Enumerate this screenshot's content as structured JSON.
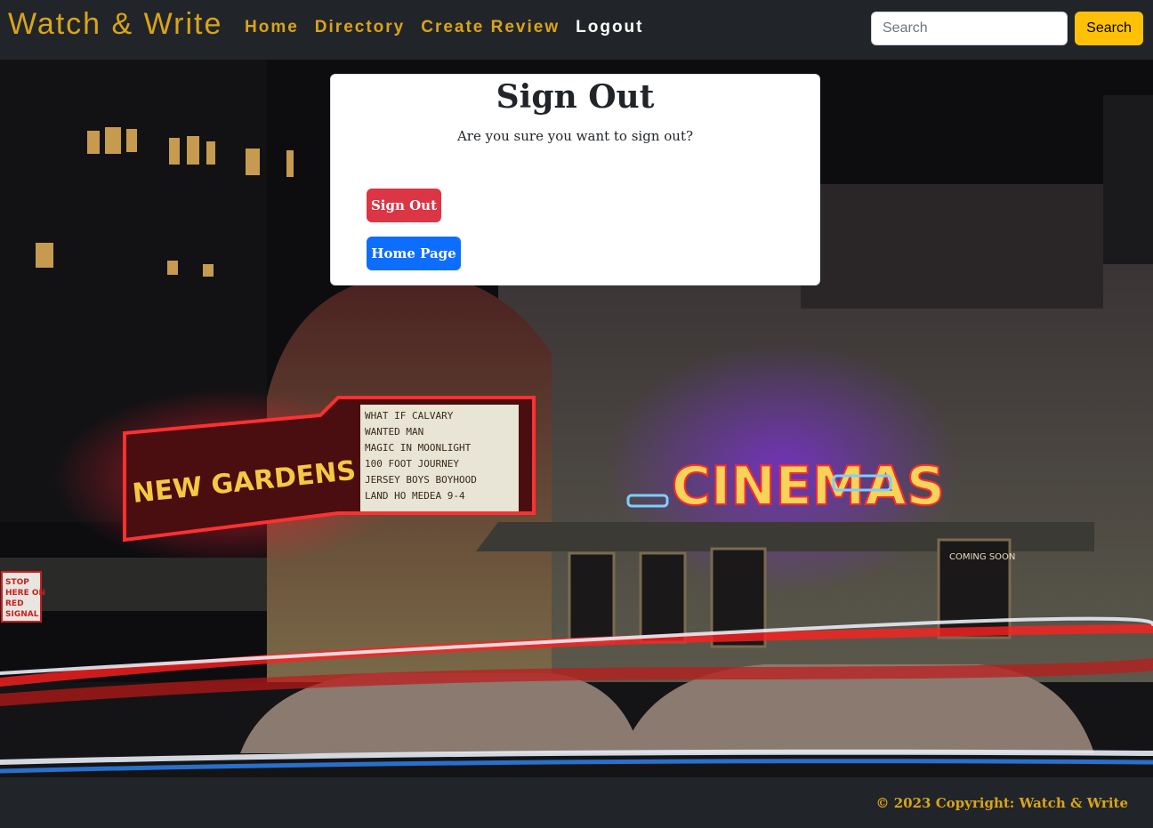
{
  "navbar": {
    "brand": "Watch & Write",
    "links": [
      {
        "label": "Home"
      },
      {
        "label": "Directory"
      },
      {
        "label": "Create Review"
      },
      {
        "label": "Logout"
      }
    ],
    "search": {
      "placeholder": "Search",
      "button_label": "Search"
    }
  },
  "card": {
    "title": "Sign Out",
    "message": "Are you sure you want to sign out?",
    "sign_out_label": "Sign Out",
    "home_label": "Home Page"
  },
  "hero": {
    "marquee_left": "NEW GARDENS CINEMAS",
    "marquee_right": "CINEMAS",
    "marquee_board": [
      "WHAT IF    CALVARY",
      "WANTED MAN",
      "MAGIC IN MOONLIGHT",
      "100 FOOT JOURNEY",
      "JERSEY BOYS  BOYHOOD",
      "LAND HO    MEDEA 9-4"
    ],
    "coming_soon": "COMING SOON",
    "stop_sign": [
      "STOP",
      "HERE ON",
      "RED",
      "SIGNAL"
    ]
  },
  "footer": {
    "text": "© 2023 Copyright: Watch & Write"
  },
  "colors": {
    "nav_bg": "#212529",
    "brand_gold": "#d9a418",
    "search_button": "#ffc107",
    "danger": "#dc3545",
    "primary": "#0d6efd"
  }
}
